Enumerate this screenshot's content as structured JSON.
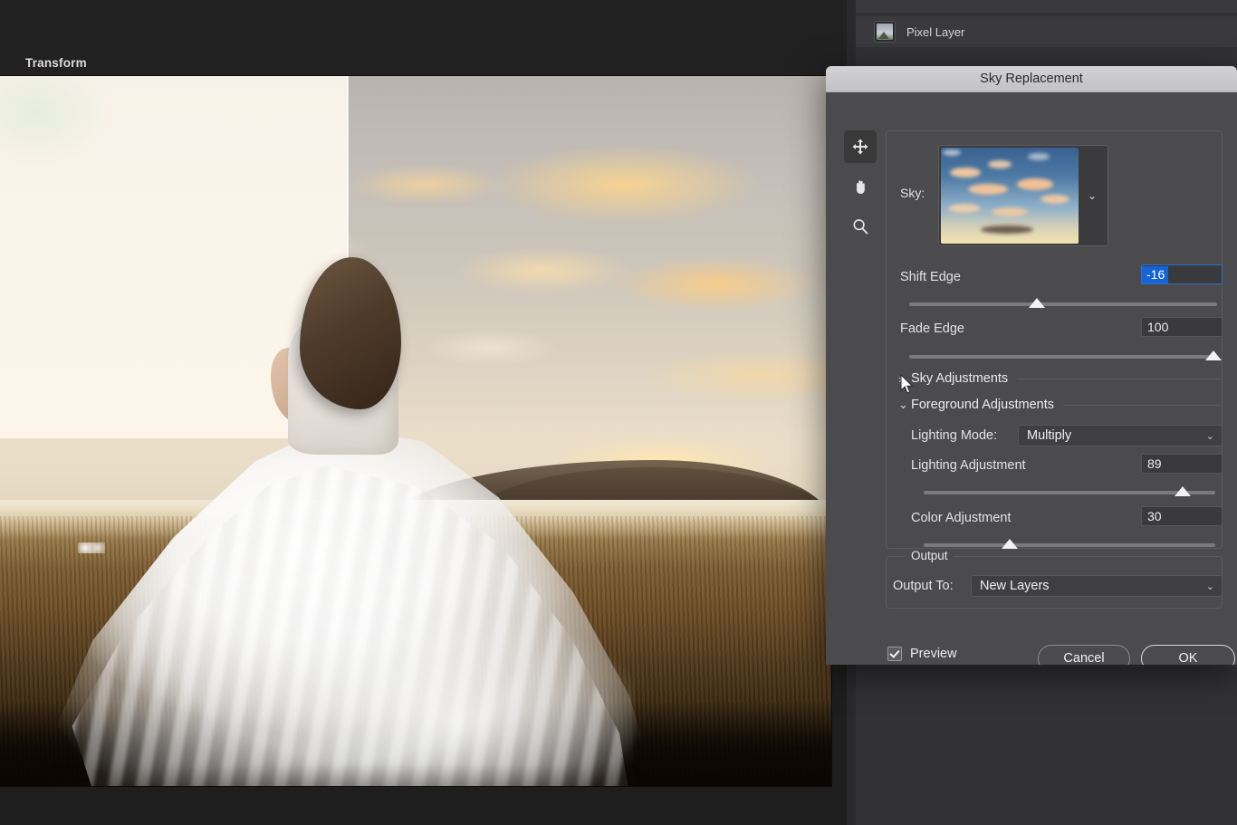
{
  "app": {
    "canvas": {
      "document_name": "",
      "split_preview": true
    },
    "right_panel": {
      "layer": {
        "icon": "pixel-layer-icon",
        "label": "Pixel Layer"
      },
      "section_title": "Transform"
    }
  },
  "dialog": {
    "title": "Sky Replacement",
    "tools": [
      {
        "name": "move-tool",
        "glyph": "move-icon",
        "selected": true
      },
      {
        "name": "hand-tool",
        "glyph": "hand-icon",
        "selected": false
      },
      {
        "name": "zoom-tool",
        "glyph": "magnifier-icon",
        "selected": false
      }
    ],
    "sky": {
      "label": "Sky:",
      "picker_chevron": "chevron-down-icon"
    },
    "shift_edge": {
      "label": "Shift Edge",
      "value": "-16",
      "slider_percent": 41
    },
    "fade_edge": {
      "label": "Fade Edge",
      "value": "100",
      "slider_percent": 100
    },
    "sky_adjustments": {
      "label": "Sky Adjustments",
      "expanded": false,
      "chevron": "chevron-right-icon"
    },
    "foreground_adjustments": {
      "label": "Foreground Adjustments",
      "expanded": true,
      "chevron": "chevron-down-icon",
      "lighting_mode": {
        "label": "Lighting Mode:",
        "value": "Multiply",
        "chevron": "chevron-down-icon"
      },
      "lighting_adjustment": {
        "label": "Lighting Adjustment",
        "value": "89",
        "slider_percent": 89
      },
      "color_adjustment": {
        "label": "Color Adjustment",
        "value": "30",
        "slider_percent": 30
      }
    },
    "output": {
      "legend": "Output",
      "output_to": {
        "label": "Output To:",
        "value": "New Layers",
        "chevron": "chevron-down-icon"
      }
    },
    "preview": {
      "label": "Preview",
      "checked": true
    },
    "cancel_label": "Cancel",
    "ok_label": "OK"
  },
  "colors": {
    "dialog_bg": "#4b4a4c",
    "titlebar": "#c9c9cc",
    "panel_bg": "#323234",
    "accent_selection": "#1464d6",
    "slider_track": "#7b7a7d",
    "text": "#ececec"
  }
}
